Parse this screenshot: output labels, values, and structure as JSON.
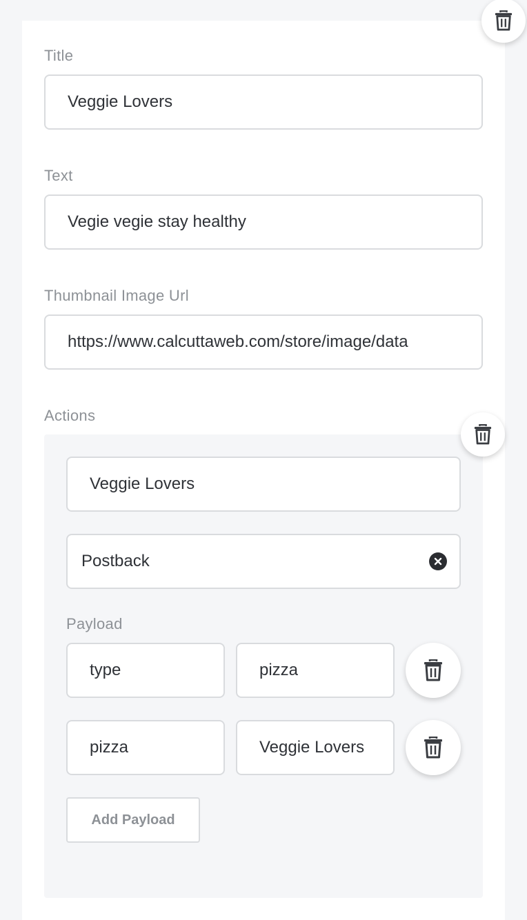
{
  "card": {
    "title_label": "Title",
    "title_value": "Veggie Lovers",
    "text_label": "Text",
    "text_value": "Vegie vegie stay healthy",
    "thumbnail_label": "Thumbnail Image Url",
    "thumbnail_value": "https://www.calcuttaweb.com/store/image/data",
    "actions_label": "Actions"
  },
  "action": {
    "label_value": "Veggie Lovers",
    "type_value": "Postback",
    "payload_label": "Payload",
    "payload_rows": [
      {
        "key": "type",
        "value": "pizza"
      },
      {
        "key": "pizza",
        "value": "Veggie Lovers"
      }
    ],
    "add_payload_label": "Add Payload"
  },
  "icons": {
    "delete": "trash-icon",
    "clear": "close-circle-icon"
  }
}
